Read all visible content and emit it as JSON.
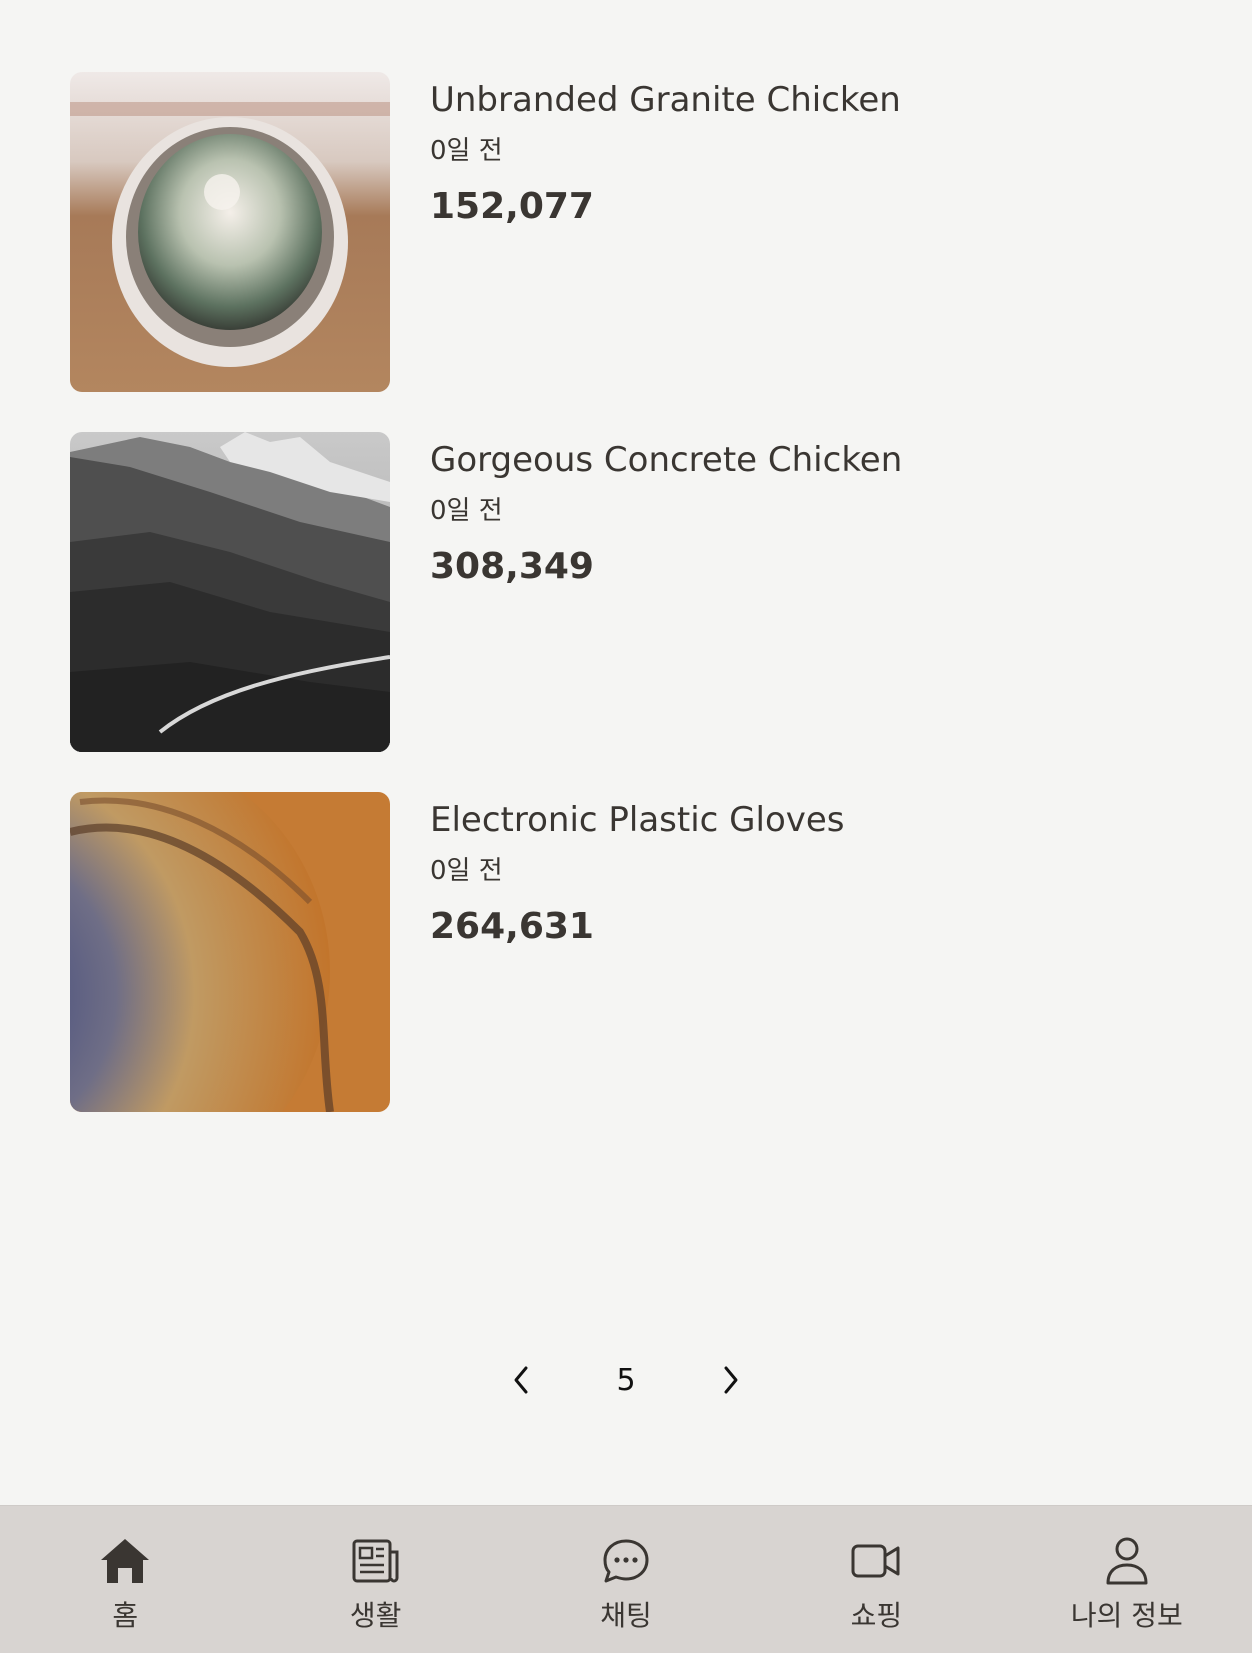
{
  "products": [
    {
      "title": "Unbranded Granite Chicken",
      "time": "0일 전",
      "price": "152,077",
      "image": "cactus-photo"
    },
    {
      "title": "Gorgeous Concrete Chicken",
      "time": "0일 전",
      "price": "308,349",
      "image": "mountain-photo"
    },
    {
      "title": "Electronic Plastic Gloves",
      "time": "0일 전",
      "price": "264,631",
      "image": "crater-photo"
    }
  ],
  "pagination": {
    "current_page": "5",
    "prev_icon": "chevron-left-icon",
    "next_icon": "chevron-right-icon"
  },
  "tabbar": {
    "items": [
      {
        "label": "홈",
        "icon": "home-icon"
      },
      {
        "label": "생활",
        "icon": "newspaper-icon"
      },
      {
        "label": "채팅",
        "icon": "chat-bubble-icon"
      },
      {
        "label": "쇼핑",
        "icon": "video-camera-icon"
      },
      {
        "label": "나의 정보",
        "icon": "user-icon"
      }
    ]
  },
  "colors": {
    "background": "#f5f5f3",
    "tabbar_background": "#d8d4d1",
    "text": "#3a3632"
  }
}
